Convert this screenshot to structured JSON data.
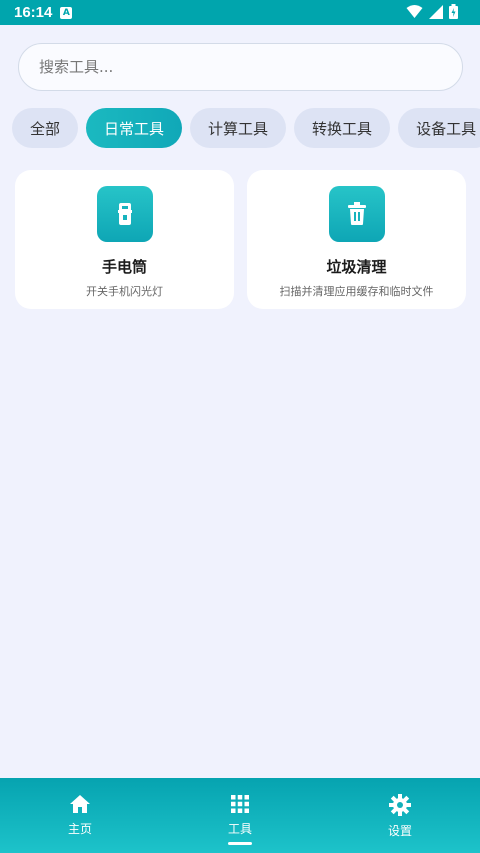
{
  "status_bar": {
    "time": "16:14"
  },
  "search": {
    "placeholder": "搜索工具..."
  },
  "categories": [
    {
      "label": "全部"
    },
    {
      "label": "日常工具",
      "active": true
    },
    {
      "label": "计算工具"
    },
    {
      "label": "转换工具"
    },
    {
      "label": "设备工具"
    }
  ],
  "tools": [
    {
      "title": "手电筒",
      "description": "开关手机闪光灯",
      "icon": "flashlight-icon"
    },
    {
      "title": "垃圾清理",
      "description": "扫描并清理应用缓存和临时文件",
      "icon": "trash-icon"
    }
  ],
  "bottom_nav": {
    "items": [
      {
        "label": "主页",
        "icon": "home-icon"
      },
      {
        "label": "工具",
        "icon": "grid-icon",
        "active": true
      },
      {
        "label": "设置",
        "icon": "gear-icon"
      }
    ]
  },
  "colors": {
    "accent": "#00a5ad",
    "background": "#f0f2fd",
    "chip": "#dde3f4"
  }
}
